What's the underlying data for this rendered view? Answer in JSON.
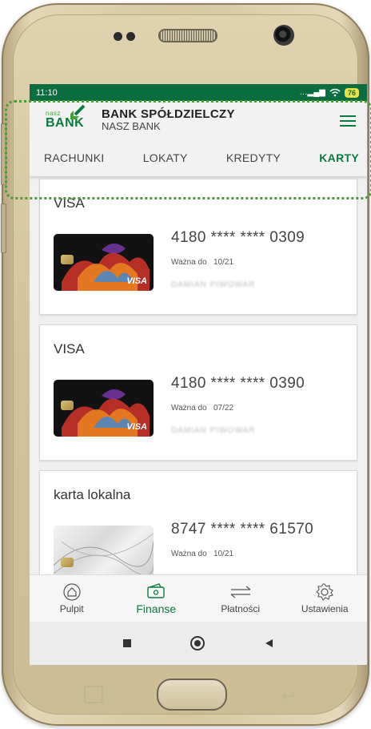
{
  "status_bar": {
    "time": "11:10",
    "battery": "76"
  },
  "header": {
    "logo_small": "nasz",
    "logo_big": "BANK",
    "bank_title": "BANK SPÓŁDZIELCZY",
    "bank_subtitle": "NASZ BANK"
  },
  "tabs": [
    {
      "label": "RACHUNKI",
      "active": false
    },
    {
      "label": "LOKATY",
      "active": false
    },
    {
      "label": "KREDYTY",
      "active": false
    },
    {
      "label": "KARTY",
      "active": true
    }
  ],
  "cards": [
    {
      "type": "VISA",
      "number": "4180 **** **** 0309",
      "valid_label": "Ważna do",
      "valid": "10/21",
      "owner": "DAMIAN PIWOWAR",
      "brand": "VISA"
    },
    {
      "type": "VISA",
      "number": "4180 **** **** 0390",
      "valid_label": "Ważna do",
      "valid": "07/22",
      "owner": "DAMIAN PIWOWAR",
      "brand": "VISA"
    },
    {
      "type": "karta lokalna",
      "number": "8747 **** **** 61570",
      "valid_label": "Ważna do",
      "valid": "10/21",
      "owner": ""
    }
  ],
  "bottom_nav": [
    {
      "label": "Pulpit",
      "icon": "home-icon",
      "active": false
    },
    {
      "label": "Finanse",
      "icon": "wallet-icon",
      "active": true
    },
    {
      "label": "Płatności",
      "icon": "transfer-icon",
      "active": false
    },
    {
      "label": "Ustawienia",
      "icon": "gear-icon",
      "active": false
    }
  ],
  "colors": {
    "brand_green": "#0b7a3e",
    "status_green": "#0a6c3f",
    "accent_light_green": "#3fa535"
  }
}
